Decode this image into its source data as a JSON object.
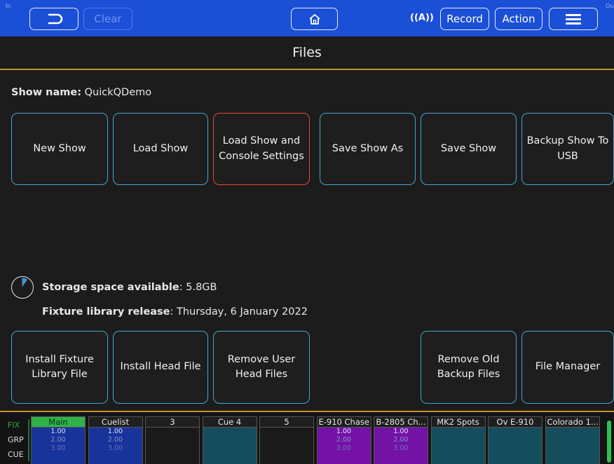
{
  "topbar": {
    "corner_left": "In",
    "corner_right": "Ou",
    "back_icon": "undo-arrow-icon",
    "clear_label": "Clear",
    "home_icon": "home-icon",
    "radio_icon_text": "((A))",
    "record_label": "Record",
    "action_label": "Action",
    "menu_icon": "hamburger-menu-icon"
  },
  "page_title": "Files",
  "show": {
    "label": "Show name:",
    "value": " QuickQDemo"
  },
  "file_buttons": [
    {
      "label": "New Show"
    },
    {
      "label": "Load Show"
    },
    {
      "label": "Load Show and Console Settings"
    },
    {
      "label": "Save Show As"
    },
    {
      "label": "Save Show"
    },
    {
      "label": "Backup Show To USB"
    }
  ],
  "storage": {
    "label": "Storage space available",
    "value": ": 5.8GB",
    "used_fraction": 0.1
  },
  "library": {
    "label": "Fixture library release",
    "value": ": Thursday, 6 January 2022"
  },
  "tool_buttons": [
    {
      "label": "Install Fixture Library File"
    },
    {
      "label": "Install Head File"
    },
    {
      "label": "Remove User Head Files"
    },
    {
      "label": "Remove Old Backup Files"
    },
    {
      "label": "File Manager"
    }
  ],
  "modes": {
    "fix": "FIX",
    "grp": "GRP",
    "cue": "CUE"
  },
  "playbacks": [
    {
      "name": "Main",
      "levels": [
        "1.00",
        "2.00",
        "3.00"
      ],
      "head_color": "#2fb24a",
      "head_text": "#0b2e12",
      "body_color": "#18339a"
    },
    {
      "name": "Cuelist",
      "levels": [
        "1.00",
        "2.00",
        "3.00"
      ],
      "head_color": "#1f1f1f",
      "head_text": "#e6e6e6",
      "body_color": "#18339a"
    },
    {
      "name": "3",
      "levels": [],
      "head_color": "#1f1f1f",
      "head_text": "#e6e6e6",
      "body_color": "#1a1a1a"
    },
    {
      "name": "Cue 4",
      "levels": [],
      "head_color": "#1f1f1f",
      "head_text": "#e6e6e6",
      "body_color": "#144e5c"
    },
    {
      "name": "5",
      "levels": [],
      "head_color": "#1f1f1f",
      "head_text": "#e6e6e6",
      "body_color": "#1a1a1a"
    },
    {
      "name": "E-910 Chase",
      "levels": [
        "1.00",
        "2.00",
        "3.00"
      ],
      "head_color": "#1f1f1f",
      "head_text": "#e6e6e6",
      "body_color": "#7412a6"
    },
    {
      "name": "B-2805 Ch...",
      "levels": [
        "1.00",
        "2.00",
        "3.00"
      ],
      "head_color": "#1f1f1f",
      "head_text": "#e6e6e6",
      "body_color": "#7412a6"
    },
    {
      "name": "MK2 Spots",
      "levels": [],
      "head_color": "#1f1f1f",
      "head_text": "#e6e6e6",
      "body_color": "#144e5c"
    },
    {
      "name": "Ov E-910",
      "levels": [],
      "head_color": "#1f1f1f",
      "head_text": "#e6e6e6",
      "body_color": "#144e5c"
    },
    {
      "name": "Colorado 1...",
      "levels": [],
      "head_color": "#1f1f1f",
      "head_text": "#e6e6e6",
      "body_color": "#144e5c"
    }
  ],
  "colors": {
    "toolbar": "#1b4fd6",
    "accent_rule": "#c8902d",
    "tile_border": "#43a6cf",
    "tile_selected": "#e2483c",
    "fix_mode": "#26b24a"
  }
}
